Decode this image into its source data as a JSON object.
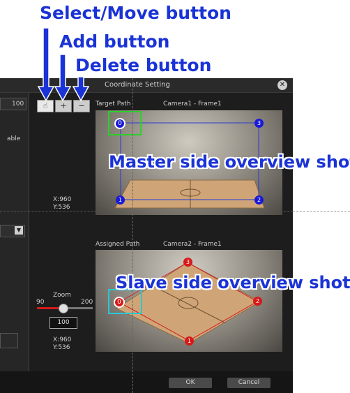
{
  "callouts": {
    "select_move": "Select/Move button",
    "add": "Add button",
    "delete": "Delete button",
    "master": "Master side overview shot",
    "slave": "Slave side overview shot"
  },
  "dialog": {
    "title": "Coordinate Setting",
    "left_value": "100",
    "left_label": "able",
    "target_path_label": "Target Path",
    "camera1_label": "Camera1 - Frame1",
    "assigned_path_label": "Assigned Path",
    "camera2_label": "Camera2 - Frame1",
    "coord_top_x": "X:960",
    "coord_top_y": "Y:536",
    "zoom_label": "Zoom",
    "zoom_min": "90",
    "zoom_max": "200",
    "zoom_value": "100",
    "coord_bottom_x": "X:960",
    "coord_bottom_y": "Y:536",
    "ok_label": "OK",
    "cancel_label": "Cancel"
  },
  "master_points": [
    "0",
    "1",
    "2",
    "3"
  ],
  "slave_points": [
    "0",
    "1",
    "2",
    "3"
  ],
  "colors": {
    "callout": "#1a33d6",
    "master_point": "#1a1ad6",
    "slave_point": "#d61a1a",
    "green_box": "#2ad12a",
    "cyan_box": "#29c7d6"
  }
}
